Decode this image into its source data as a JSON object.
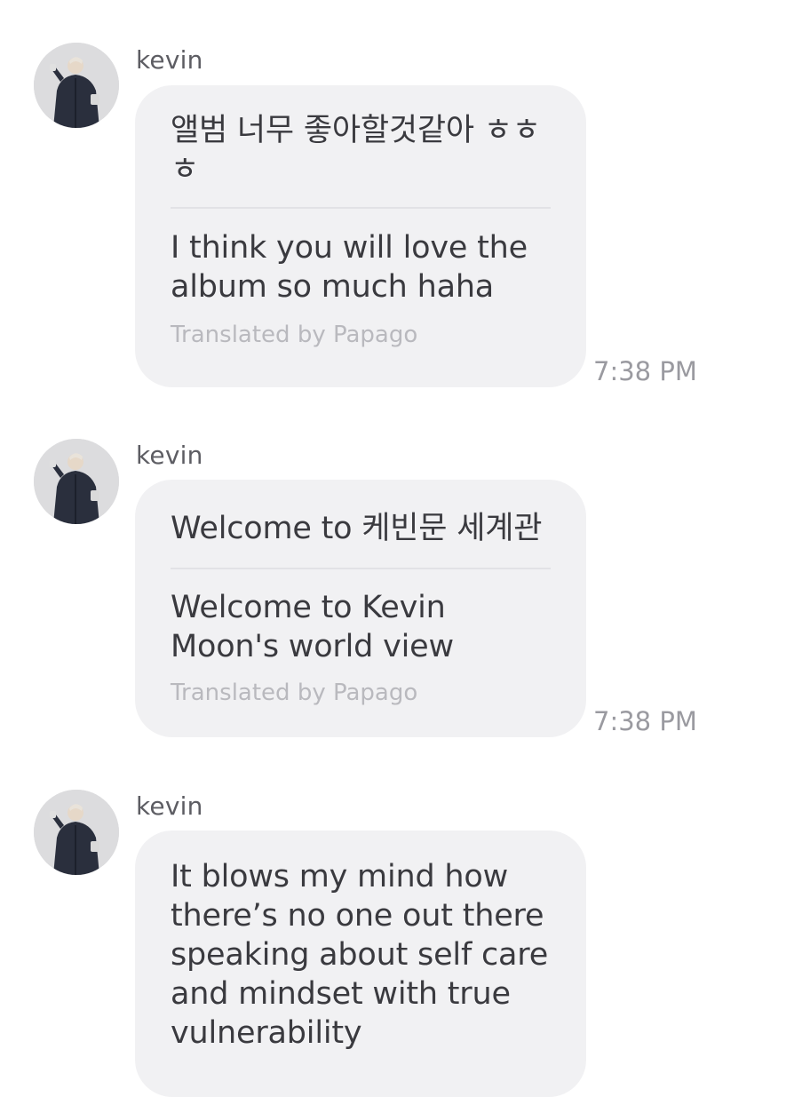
{
  "messages": [
    {
      "sender": "kevin",
      "original": "앨범 너무 좋아할것같아 ㅎㅎ\nㅎ",
      "translation": "I think you will love the\nalbum so much haha",
      "credit": "Translated by Papago",
      "time": "7:38 PM"
    },
    {
      "sender": "kevin",
      "original": "Welcome to 케빈문 세계관",
      "translation": "Welcome to Kevin\nMoon's world view",
      "credit": "Translated by Papago",
      "time": "7:38 PM"
    },
    {
      "sender": "kevin",
      "text": "It blows my mind how\nthere’s no one out there\nspeaking about self care\nand mindset with true\nvulnerability"
    }
  ]
}
